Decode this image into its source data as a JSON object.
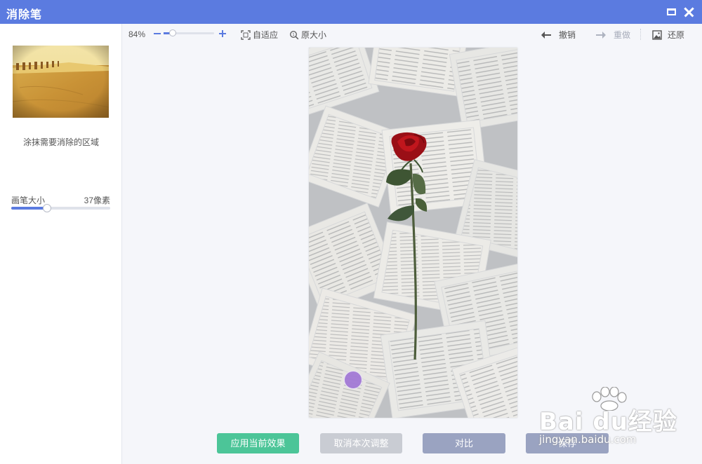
{
  "window": {
    "title": "消除笔",
    "maximize_icon": "maximize-icon",
    "close_icon": "close-icon",
    "title_bar_color": "#5b7be0"
  },
  "sidebar": {
    "hint": "涂抹需要消除的区域",
    "brush_size_label": "画笔大小",
    "brush_size_value": "37像素",
    "brush_size_fraction": 0.36
  },
  "toolbar": {
    "zoom_percent": "84%",
    "zoom_fraction": 0.18,
    "fit_label": "自适应",
    "original_size_label": "原大小",
    "undo_label": "撤销",
    "redo_label": "重做",
    "restore_label": "还原"
  },
  "actions": {
    "apply_label": "应用当前效果",
    "cancel_label": "取消本次调整",
    "compare_label": "对比",
    "save_label": "保存"
  },
  "watermark": {
    "brand": "Bai du经验",
    "url": "jingyan.baidu.com"
  },
  "colors": {
    "accent": "#5b7be0",
    "apply": "#4cc598",
    "disabled": "#c9ccd3",
    "secondary": "#9aa3c1"
  }
}
